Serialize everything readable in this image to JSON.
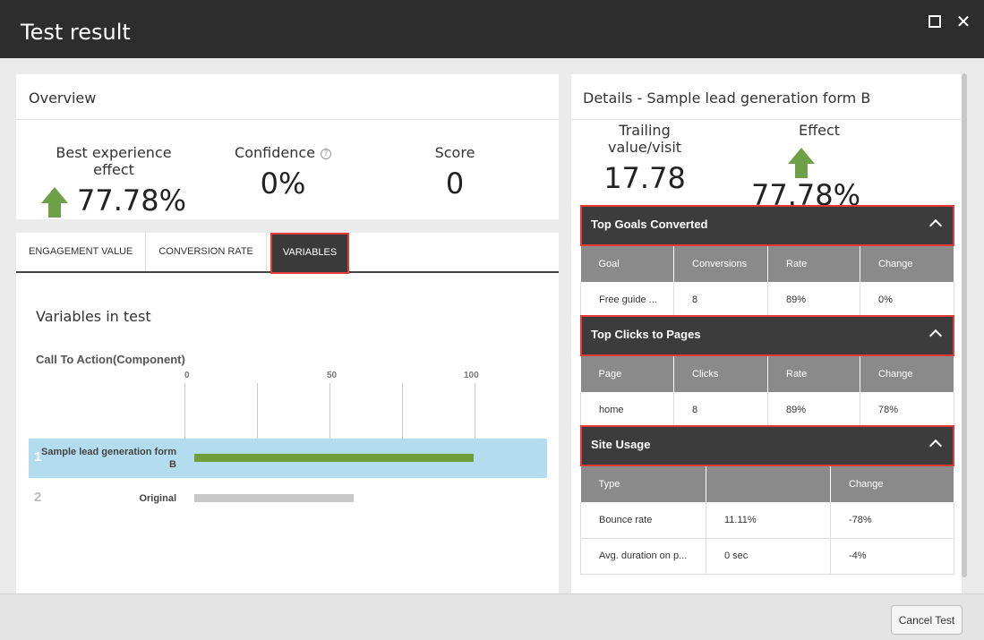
{
  "window": {
    "title": "Test result"
  },
  "overview": {
    "heading": "Overview",
    "best_label": "Best experience effect",
    "best_value": "77.78%",
    "confidence_label": "Confidence",
    "confidence_value": "0%",
    "score_label": "Score",
    "score_value": "0"
  },
  "tabs": [
    {
      "label": "ENGAGEMENT VALUE"
    },
    {
      "label": "CONVERSION RATE"
    },
    {
      "label": "VARIABLES"
    }
  ],
  "variables": {
    "title": "Variables in test",
    "component": "Call To Action(Component)",
    "axis_ticks": [
      "0",
      "50",
      "100"
    ],
    "rows": [
      {
        "num": "1",
        "name": "Sample lead generation form B",
        "value": 100,
        "color": "#6e9f3a"
      },
      {
        "num": "2",
        "name": "Original",
        "value": 57,
        "color": "#c8c8c8"
      }
    ]
  },
  "details": {
    "heading": "Details - Sample lead generation form B",
    "trailing_label": "Trailing value/visit",
    "trailing_value": "17.78",
    "effect_label": "Effect",
    "effect_value": "77.78%",
    "goals": {
      "title": "Top Goals Converted",
      "headers": [
        "Goal",
        "Conversions",
        "Rate",
        "Change"
      ],
      "rows": [
        [
          "Free guide ...",
          "8",
          "89%",
          "0%"
        ]
      ]
    },
    "clicks": {
      "title": "Top Clicks to Pages",
      "headers": [
        "Page",
        "Clicks",
        "Rate",
        "Change"
      ],
      "rows": [
        [
          "home",
          "8",
          "89%",
          "78%"
        ]
      ]
    },
    "usage": {
      "title": "Site Usage",
      "headers": [
        "Type",
        "",
        "Change"
      ],
      "rows": [
        [
          "Bounce rate",
          "11.11%",
          "-78%"
        ],
        [
          "Avg. duration on p...",
          "0 sec",
          "-4%"
        ]
      ]
    }
  },
  "footer": {
    "cancel_label": "Cancel Test"
  },
  "colors": {
    "accent_red": "#e53935",
    "arrow_green": "#6ea047",
    "header_dark": "#2d2d2d"
  }
}
